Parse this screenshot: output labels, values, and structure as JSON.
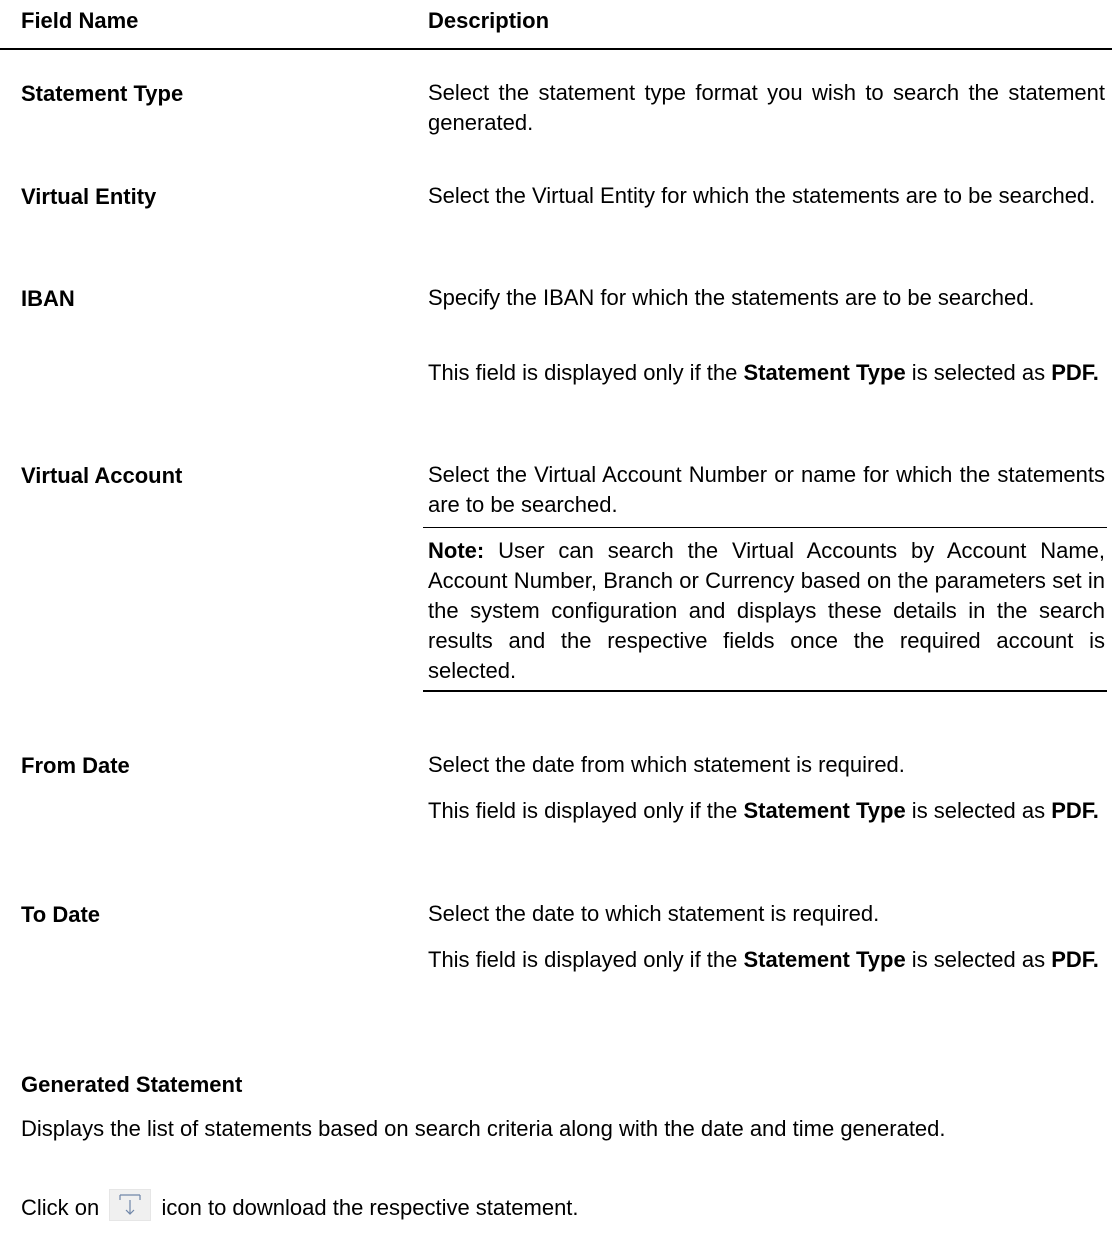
{
  "table": {
    "headers": {
      "field": "Field Name",
      "description": "Description"
    },
    "rows": [
      {
        "field": "Statement Type",
        "desc": "Select the statement type format you wish to search the statement generated."
      },
      {
        "field": "Virtual Entity",
        "desc": "Select the Virtual Entity for which the statements are to be searched."
      },
      {
        "field": "IBAN",
        "desc": "Specify the IBAN for which the statements are to be searched.",
        "note_pre": "This field is displayed only if the ",
        "note_b1": "Statement Type",
        "note_mid": " is selected as ",
        "note_b2": "PDF."
      },
      {
        "field": "Virtual Account",
        "desc": "Select the Virtual Account Number or name for which the statements are to be searched.",
        "note_label": "Note:",
        "note_text": " User can search the Virtual Accounts by Account Name, Account Number, Branch or Currency based on the parameters set in the system configuration and displays these details in the search results and the respective fields once the required account is selected."
      },
      {
        "field": "From Date",
        "desc": "Select the date from which statement is required.",
        "note_pre": "This field is displayed only if the ",
        "note_b1": "Statement Type",
        "note_mid": " is selected as ",
        "note_b2": "PDF."
      },
      {
        "field": "To Date",
        "desc": "Select the date to which statement is required.",
        "note_pre": "This field is displayed only if the ",
        "note_b1": "Statement Type",
        "note_mid": " is selected as ",
        "note_b2": "PDF."
      }
    ]
  },
  "generated": {
    "heading": "Generated Statement",
    "text": "Displays the list of statements based on search criteria along with the date and time generated.",
    "click_pre": "Click on",
    "click_post": "icon to download the respective statement.",
    "icon": "download-icon"
  }
}
